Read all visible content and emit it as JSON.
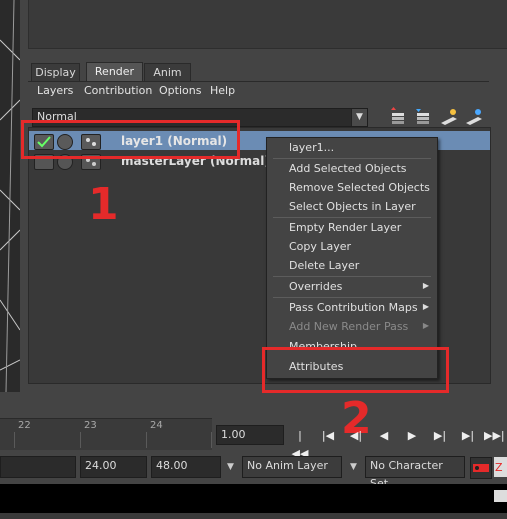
{
  "tabs": [
    {
      "label": "Display",
      "active": false
    },
    {
      "label": "Render",
      "active": true
    },
    {
      "label": "Anim",
      "active": false
    }
  ],
  "menubar": {
    "items": [
      "Layers",
      "Contribution",
      "Options",
      "Help"
    ]
  },
  "blend_mode": {
    "value": "Normal"
  },
  "toolbar_icons": [
    "new-layer-icon",
    "new-layer-selected-icon",
    "move-up-icon",
    "move-down-icon"
  ],
  "layers": [
    {
      "name": "layer1 (Normal)",
      "selected": true
    },
    {
      "name": "masterLayer (Normal)",
      "selected": false
    }
  ],
  "context_menu": {
    "items": [
      {
        "label": "layer1...",
        "disabled": false
      },
      {
        "label": "Add Selected Objects",
        "disabled": false
      },
      {
        "label": "Remove Selected Objects",
        "disabled": false
      },
      {
        "label": "Select Objects in Layer",
        "disabled": false
      },
      {
        "label": "Empty Render Layer",
        "disabled": false
      },
      {
        "label": "Copy Layer",
        "disabled": false
      },
      {
        "label": "Delete Layer",
        "disabled": false
      },
      {
        "label": "Overrides",
        "disabled": false,
        "submenu": true
      },
      {
        "label": "Pass Contribution Maps",
        "disabled": false,
        "submenu": true
      },
      {
        "label": "Add New Render Pass",
        "disabled": true,
        "submenu": true
      },
      {
        "label": "Membership",
        "disabled": false
      },
      {
        "label": "Attributes",
        "disabled": false
      }
    ]
  },
  "annotations": {
    "step1": "1",
    "step2": "2",
    "color": "#e52a2a"
  },
  "timeline": {
    "ticks": [
      "22",
      "23",
      "24"
    ],
    "current_frame": "1.00"
  },
  "range": {
    "start": "24.00",
    "end": "48.00",
    "anim_layer": "No Anim Layer",
    "character_set": "No Character Set"
  },
  "accent": {
    "selection": "#6b8cb4"
  }
}
